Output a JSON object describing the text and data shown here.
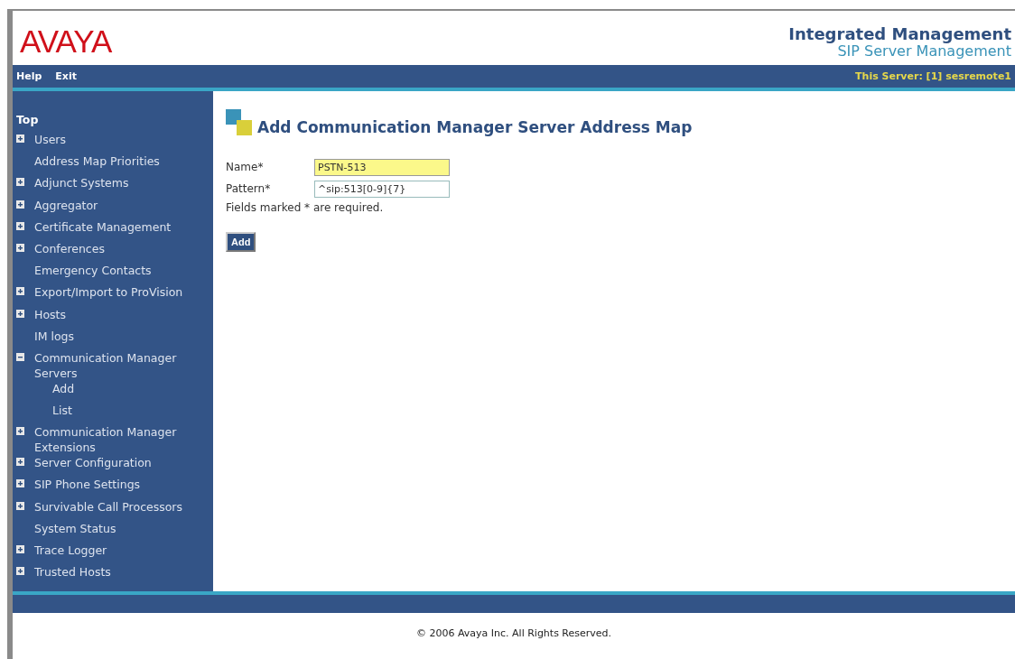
{
  "header": {
    "logo": "AVAYA",
    "title": "Integrated Management",
    "subtitle": "SIP Server Management"
  },
  "nav": {
    "links": [
      "Help",
      "Exit"
    ],
    "server": "This Server: [1] sesremote1"
  },
  "sidebar": {
    "heading": "Top",
    "items": [
      {
        "label": "Users",
        "kind": "group",
        "expanded": false
      },
      {
        "label": "Address Map Priorities",
        "kind": "link"
      },
      {
        "label": "Adjunct Systems",
        "kind": "group",
        "expanded": false
      },
      {
        "label": "Aggregator",
        "kind": "group",
        "expanded": false
      },
      {
        "label": "Certificate Management",
        "kind": "group",
        "expanded": false
      },
      {
        "label": "Conferences",
        "kind": "group",
        "expanded": false
      },
      {
        "label": "Emergency Contacts",
        "kind": "link"
      },
      {
        "label": "Export/Import to ProVision",
        "kind": "group",
        "expanded": false
      },
      {
        "label": "Hosts",
        "kind": "group",
        "expanded": false
      },
      {
        "label": "IM logs",
        "kind": "link"
      },
      {
        "label": "Communication Manager Servers",
        "kind": "group",
        "expanded": true,
        "children": [
          {
            "label": "Add"
          },
          {
            "label": "List"
          }
        ]
      },
      {
        "label": "Communication Manager Extensions",
        "kind": "group",
        "expanded": false
      },
      {
        "label": "Server Configuration",
        "kind": "group",
        "expanded": false
      },
      {
        "label": "SIP Phone Settings",
        "kind": "group",
        "expanded": false
      },
      {
        "label": "Survivable Call Processors",
        "kind": "group",
        "expanded": false
      },
      {
        "label": "System Status",
        "kind": "link"
      },
      {
        "label": "Trace Logger",
        "kind": "group",
        "expanded": false
      },
      {
        "label": "Trusted Hosts",
        "kind": "group",
        "expanded": false
      }
    ]
  },
  "form": {
    "title": "Add Communication Manager Server Address Map",
    "fields": [
      {
        "label": "Name*",
        "value": "PSTN-513",
        "focused": true
      },
      {
        "label": "Pattern*",
        "value": "^sip:513[0-9]{7}",
        "focused": false
      }
    ],
    "note": "Fields marked * are required.",
    "button": "Add"
  },
  "footer": "© 2006 Avaya Inc. All Rights Reserved."
}
